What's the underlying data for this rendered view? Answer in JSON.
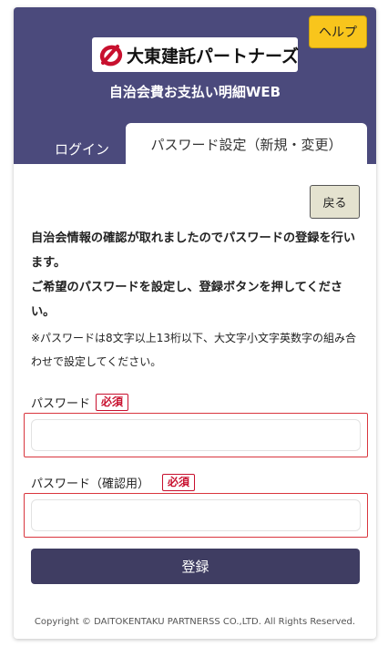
{
  "header": {
    "help_label": "ヘルプ",
    "logo_text": "大東建託パートナーズ",
    "site_title": "自治会費お支払い明細WEB",
    "colors": {
      "header_bg": "#4b4a7c",
      "help_bg": "#f8c51c",
      "logo_red": "#c8102e"
    }
  },
  "tabs": {
    "login_label": "ログイン",
    "password_label": "パスワード設定（新規・変更）"
  },
  "back_label": "戻る",
  "message": {
    "line1": "自治会情報の確認が取れましたのでパスワードの登録を行います。",
    "line2": "ご希望のパスワードを設定し、登録ボタンを押してください。",
    "note": "※パスワードは8文字以上13桁以下、大文字小文字英数字の組み合わせで設定してください。"
  },
  "form": {
    "password_label": "パスワード",
    "password_confirm_label": "パスワード（確認用）",
    "required_badge": "必須",
    "password_value": "",
    "password_confirm_value": ""
  },
  "submit_label": "登録",
  "footer": {
    "copyright": "Copyright © DAITOKENTAKU PARTNERSS CO.,LTD. All Rights Reserved."
  }
}
